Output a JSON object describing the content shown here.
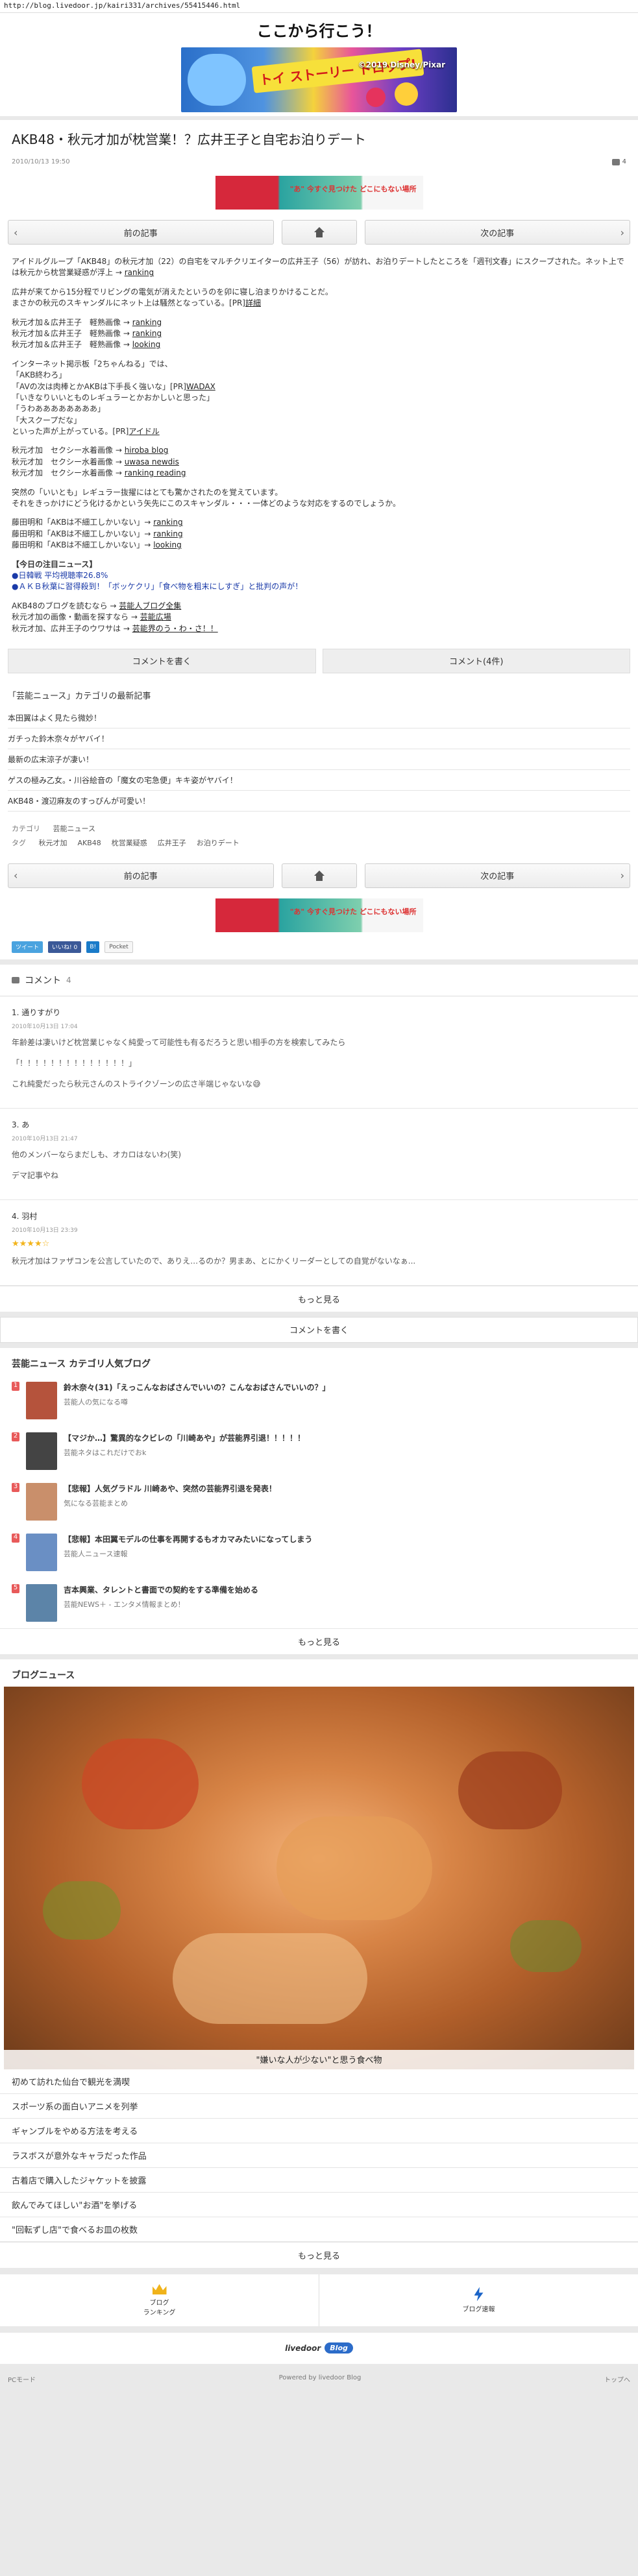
{
  "url": "http://blog.livedoor.jp/kairi331/archives/55415446.html",
  "site": {
    "title": "ここから行こう！",
    "banner": {
      "headline": "トイ ストーリー ドロップ!",
      "copyright": "©2019 Disney/Pixar"
    }
  },
  "article": {
    "title": "AKB48・秋元才加が枕営業！？広井王子と自宅お泊りデート",
    "date": "2010/10/13 19:50",
    "comment_count": "4"
  },
  "ad_text": "\"あ\" 今すぐ見つけた どこにもない場所",
  "nav": {
    "prev": "前の記事",
    "next": "次の記事"
  },
  "body": [
    {
      "t": "アイドルグループ「AKB48」の秋元才加（22）の自宅をマルチクリエイターの広井王子（56）が訪れ、お泊りデートしたところを「週刊文春」にスクープされた。ネット上では秋元から枕営業疑惑が浮上 → ",
      "link": "ranking"
    },
    {
      "t": "",
      "gap": true
    },
    {
      "t": "広井が来てから15分程でリビングの電気が消えたというのを卯に寝し泊まりかけることだ。"
    },
    {
      "t": "まさかの秋元のスキャンダルにネット上は騒然となっている。[PR]",
      "link": "詳細"
    },
    {
      "t": "",
      "gap": true
    },
    {
      "t": "秋元才加＆広井王子　軽熟画像 → ",
      "link": "ranking"
    },
    {
      "t": "秋元才加＆広井王子　軽熟画像 → ",
      "link": "ranking"
    },
    {
      "t": "秋元才加＆広井王子　軽熟画像 → ",
      "link": "looking"
    },
    {
      "t": "",
      "gap": true
    },
    {
      "t": "インターネット掲示板「2ちゃんねる」では、"
    },
    {
      "t": "「AKB終わろ」"
    },
    {
      "t": "「AVの次は肉棒とかAKBは下手長く強いな」[PR]",
      "link": "WADAX"
    },
    {
      "t": "「いきなりいいとものレギュラーとかおかしいと思った」"
    },
    {
      "t": "「うわああああああああ」"
    },
    {
      "t": "「大スクープだな」"
    },
    {
      "t": "といった声が上がっている。[PR]",
      "link": "アイドル"
    },
    {
      "t": "",
      "gap": true
    },
    {
      "t": "秋元才加　セクシー水着画像 → ",
      "link": "hiroba blog"
    },
    {
      "t": "秋元才加　セクシー水着画像 → ",
      "link": "uwasa newdis"
    },
    {
      "t": "秋元才加　セクシー水着画像 → ",
      "link": "ranking reading"
    },
    {
      "t": "",
      "gap": true
    },
    {
      "t": "突然の「いいとも」レギュラー抜擢にはとても驚かされたのを覚えています。"
    },
    {
      "t": "それをきっかけにどう化けるかという矢先にこのスキャンダル・・・一体どのような対応をするのでしょうか。"
    },
    {
      "t": "",
      "gap": true
    },
    {
      "t": "藤田明和「AKBは不細工しかいない」→ ",
      "link": "ranking"
    },
    {
      "t": "藤田明和「AKBは不細工しかいない」→ ",
      "link": "ranking"
    },
    {
      "t": "藤田明和「AKBは不細工しかいない」→ ",
      "link": "looking"
    },
    {
      "t": "",
      "gap": true
    },
    {
      "t": "【今日の注目ニュース】",
      "head": true
    },
    {
      "t": "●日韓戦 平均視聴率26.8%",
      "blue": true
    },
    {
      "t": "●ＡＫＢ秋葉に習得殺到！「ボッケクリ」「食べ物を粗末にしすぎ」と批判の声が！",
      "blue": true
    },
    {
      "t": "",
      "gap": true
    },
    {
      "t": "AKB48のブログを読むなら → ",
      "link": "芸能人ブログ全集"
    },
    {
      "t": "秋元才加の画像・動画を探すなら → ",
      "link": "芸能広場"
    },
    {
      "t": "秋元才加、広井王子のウワサは → ",
      "link": "芸能界のう・わ・さ！！"
    }
  ],
  "actions": {
    "write_comment": "コメントを書く",
    "view_comments": "コメント(4件)"
  },
  "category": {
    "title": "「芸能ニュース」カテゴリの最新記事",
    "items": [
      "本田翼はよく見たら微妙！",
      "ガチった鈴木奈々がヤバイ！",
      "最新の広末涼子が凄い！",
      "ゲスの極み乙女。・川谷絵音の「魔女の宅急便」キキ姿がヤバイ！",
      "AKB48・渡辺麻友のすっぴんが可愛い！"
    ],
    "category_label": "カテゴリ",
    "category_value": "芸能ニュース",
    "tag_label": "タグ",
    "tags": [
      "秋元才加",
      "AKB48",
      "枕営業疑惑",
      "広井王子",
      "お泊りデート"
    ]
  },
  "social": {
    "tweet": "ツイート",
    "like": "いいね! 0",
    "hatena": "B!",
    "pocket": "Pocket"
  },
  "comments": {
    "title": "コメント",
    "count": "4",
    "list": [
      {
        "name": "1. 通りすがり",
        "date": "2010年10月13日 17:04",
        "lines": [
          "年齢差は凄いけど枕営業じゃなく純愛って可能性も有るだろうと思い相手の方を検索してみたら",
          "「！！！！！！！！！！！！！！」",
          "これ純愛だったら秋元さんのストライクゾーンの広さ半端じゃないな😅"
        ]
      },
      {
        "name": "3. あ",
        "date": "2010年10月13日 21:47",
        "lines": [
          "他のメンバーならまだしも、オカロはないわ(笑)",
          "デマ記事やね"
        ]
      },
      {
        "name": "4. 羽村",
        "date": "2010年10月13日 23:39",
        "stars": "★★★★☆",
        "lines": [
          "秋元才加はファザコンを公言していたので、ありえ…るのか？男まあ、とにかくリーダーとしての自覚がないなぁ..."
        ]
      }
    ],
    "more": "もっと見る"
  },
  "write_comment": "コメントを書く",
  "popular": {
    "title": "芸能ニュース カテゴリ人気ブログ",
    "items": [
      {
        "rank": "1",
        "title": "鈴木奈々(31)「えっこんなおばさんでいいの？こんなおばさんでいいの？」",
        "source": "芸能人の気になる噂",
        "color": "#b5533c"
      },
      {
        "rank": "2",
        "title": "【マジか…】驚異的なクビレの「川崎あや」が芸能界引退！！！！！",
        "source": "芸能ネタはこれだけでおk",
        "color": "#444"
      },
      {
        "rank": "3",
        "title": "【悲報】人気グラドル 川崎あや、突然の芸能界引退を発表！",
        "source": "気になる芸能まとめ",
        "color": "#c98f6b"
      },
      {
        "rank": "4",
        "title": "【悲報】本田翼モデルの仕事を再開するもオカマみたいになってしまう",
        "source": "芸能人ニュース速報",
        "color": "#6a8fc4"
      },
      {
        "rank": "5",
        "title": "吉本興業、タレントと書面での契約をする準備を始める",
        "source": "芸能NEWS＋ - エンタメ情報まとめ！",
        "color": "#5c84a8"
      }
    ],
    "more": "もっと見る"
  },
  "blog_news": {
    "title": "ブログニュース",
    "hero_caption": "\"嫌いな人が少ない\"と思う食べ物",
    "items": [
      "初めて訪れた仙台で観光を満喫",
      "スポーツ系の面白いアニメを列挙",
      "ギャンブルをやめる方法を考える",
      "ラスボスが意外なキャラだった作品",
      "古着店で購入したジャケットを披露",
      "飲んでみてほしい\"お酒\"を挙げる",
      "\"回転ずし店\"で食べるお皿の枚数"
    ],
    "more": "もっと見る"
  },
  "footer": {
    "ranking": "ブログ\nランキング",
    "speed": "ブログ速報",
    "logo_text": "livedoor",
    "logo_badge": "Blog",
    "pc_mode": "PCモード",
    "powered": "Powered by livedoor Blog",
    "top": "トップへ"
  }
}
